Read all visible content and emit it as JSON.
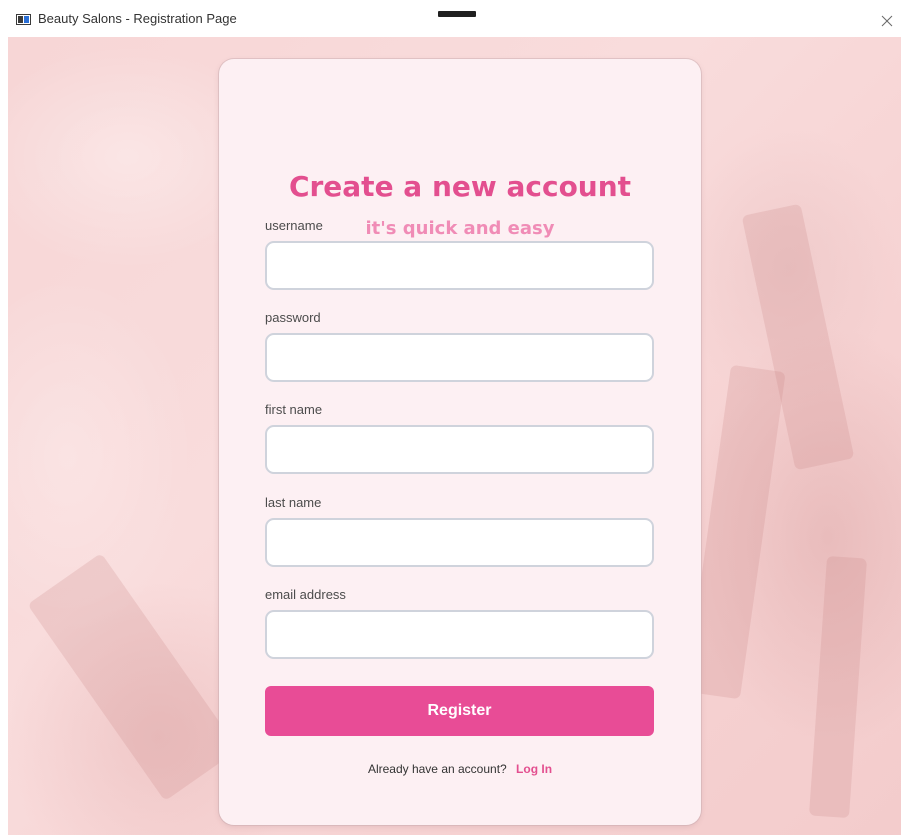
{
  "window": {
    "title": "Beauty Salons - Registration Page"
  },
  "form": {
    "heading": "Create a new account",
    "subheading": "it's quick and easy",
    "fields": [
      {
        "label": "username",
        "value": "",
        "placeholder": ""
      },
      {
        "label": "password",
        "value": "",
        "placeholder": ""
      },
      {
        "label": "first name",
        "value": "",
        "placeholder": ""
      },
      {
        "label": "last name",
        "value": "",
        "placeholder": ""
      },
      {
        "label": "email address",
        "value": "",
        "placeholder": ""
      }
    ],
    "register_label": "Register",
    "login_prompt": "Already have an account?",
    "login_link": "Log In"
  },
  "colors": {
    "accent": "#e84c96",
    "heading": "#e34f8f",
    "subheading": "#f08cb6",
    "card": "#fdf0f3",
    "background": "#f7d6d6"
  },
  "icons": {
    "app": "window-app-icon",
    "close": "close-icon"
  }
}
